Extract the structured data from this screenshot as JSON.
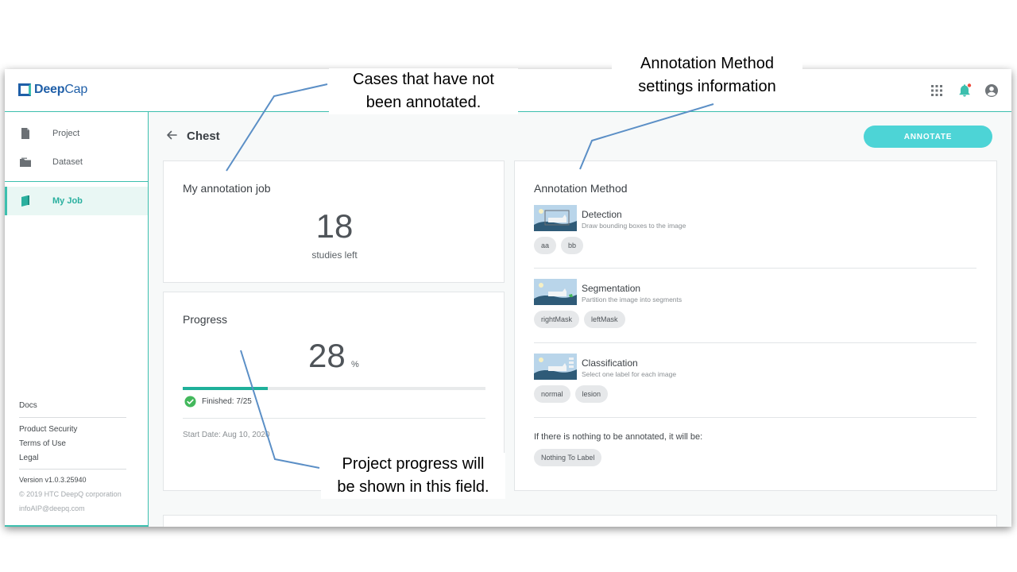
{
  "app": {
    "logo_bold": "Deep",
    "logo_light": "Cap"
  },
  "header": {
    "icons": [
      "apps-icon",
      "bell-icon",
      "account-icon"
    ],
    "notification_dot_color": "#ef4a3c"
  },
  "sidebar": {
    "items": [
      {
        "label": "Project",
        "icon": "file-icon"
      },
      {
        "label": "Dataset",
        "icon": "folder-icon"
      },
      {
        "label": "My Job",
        "icon": "book-icon",
        "active": true
      }
    ],
    "footer": {
      "docs": "Docs",
      "links": [
        "Product Security",
        "Terms of Use",
        "Legal"
      ],
      "version": "Version v1.0.3.25940",
      "copyright": "© 2019 HTC DeepQ corporation",
      "email": "infoAIP@deepq.com"
    }
  },
  "page": {
    "title": "Chest",
    "annotate_label": "ANNOTATE"
  },
  "job": {
    "title": "My annotation job",
    "count": "18",
    "count_label": "studies left"
  },
  "progress": {
    "title": "Progress",
    "value": "28",
    "unit": "%",
    "fraction": 0.28,
    "finished": "Finished: 7/25",
    "start_date": "Start Date: Aug 10, 2020"
  },
  "method": {
    "title": "Annotation Method",
    "items": [
      {
        "name": "Detection",
        "desc": "Draw bounding boxes to the image",
        "labels": [
          "aa",
          "bb"
        ]
      },
      {
        "name": "Segmentation",
        "desc": "Partition the image into segments",
        "labels": [
          "rightMask",
          "leftMask"
        ]
      },
      {
        "name": "Classification",
        "desc": "Select one label for each image",
        "labels": [
          "normal",
          "lesion"
        ]
      }
    ],
    "empty_note": "If there is nothing to be annotated, it will be:",
    "empty_label": "Nothing To Label"
  },
  "callouts": {
    "cases": "Cases that have not\nbeen annotated.",
    "method": "Annotation Method\nsettings information",
    "progress": "Project progress will\nbe shown in this field."
  },
  "colors": {
    "accent": "#3cbfae",
    "brand": "#1f5fa8",
    "button": "#4dd4d6",
    "progress": "#1fb09a",
    "callout_line": "#5b8fc6"
  }
}
